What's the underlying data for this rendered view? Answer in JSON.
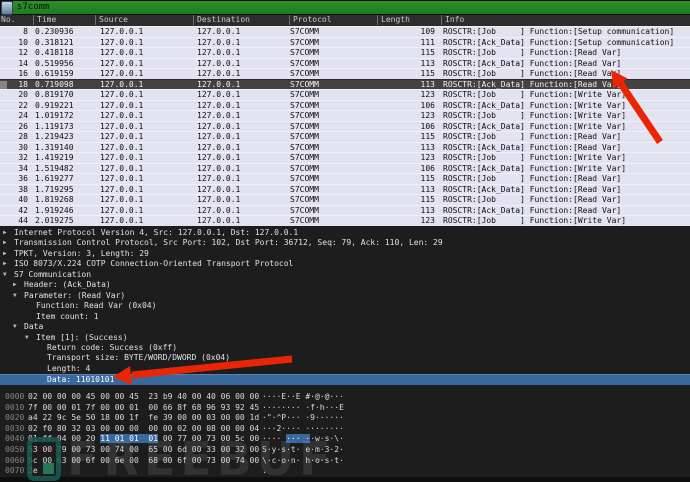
{
  "filter_bar": {
    "value": "s7comm"
  },
  "colors": {
    "filter_green": "#1e7c1e",
    "row_bg": "#e3e2f0",
    "row_selected_bg": "#45413c",
    "selection_blue": "#38689c",
    "annotation_red": "#e82504",
    "pane_bg": "#1d1d1d"
  },
  "packet_list": {
    "columns": [
      "No.",
      "Time",
      "Source",
      "Destination",
      "Protocol",
      "Length",
      "Info"
    ],
    "rows": [
      {
        "no": "8",
        "time": "0.230936",
        "source": "127.0.0.1",
        "destination": "127.0.0.1",
        "protocol": "S7COMM",
        "length": "109",
        "info": "ROSCTR:[Job     ] Function:[Setup communication]",
        "selected": false
      },
      {
        "no": "10",
        "time": "0.318121",
        "source": "127.0.0.1",
        "destination": "127.0.0.1",
        "protocol": "S7COMM",
        "length": "111",
        "info": "ROSCTR:[Ack_Data] Function:[Setup communication]",
        "selected": false
      },
      {
        "no": "12",
        "time": "0.418118",
        "source": "127.0.0.1",
        "destination": "127.0.0.1",
        "protocol": "S7COMM",
        "length": "115",
        "info": "ROSCTR:[Job     ] Function:[Read Var]",
        "selected": false
      },
      {
        "no": "14",
        "time": "0.519956",
        "source": "127.0.0.1",
        "destination": "127.0.0.1",
        "protocol": "S7COMM",
        "length": "113",
        "info": "ROSCTR:[Ack_Data] Function:[Read Var]",
        "selected": false
      },
      {
        "no": "16",
        "time": "0.619159",
        "source": "127.0.0.1",
        "destination": "127.0.0.1",
        "protocol": "S7COMM",
        "length": "115",
        "info": "ROSCTR:[Job     ] Function:[Read Var]",
        "selected": false
      },
      {
        "no": "18",
        "time": "0.719098",
        "source": "127.0.0.1",
        "destination": "127.0.0.1",
        "protocol": "S7COMM",
        "length": "113",
        "info": "ROSCTR:[Ack_Data] Function:[Read Var]",
        "selected": true
      },
      {
        "no": "20",
        "time": "0.819170",
        "source": "127.0.0.1",
        "destination": "127.0.0.1",
        "protocol": "S7COMM",
        "length": "123",
        "info": "ROSCTR:[Job     ] Function:[Write Var]",
        "selected": false
      },
      {
        "no": "22",
        "time": "0.919221",
        "source": "127.0.0.1",
        "destination": "127.0.0.1",
        "protocol": "S7COMM",
        "length": "106",
        "info": "ROSCTR:[Ack_Data] Function:[Write Var]",
        "selected": false
      },
      {
        "no": "24",
        "time": "1.019172",
        "source": "127.0.0.1",
        "destination": "127.0.0.1",
        "protocol": "S7COMM",
        "length": "123",
        "info": "ROSCTR:[Job     ] Function:[Write Var]",
        "selected": false
      },
      {
        "no": "26",
        "time": "1.119173",
        "source": "127.0.0.1",
        "destination": "127.0.0.1",
        "protocol": "S7COMM",
        "length": "106",
        "info": "ROSCTR:[Ack_Data] Function:[Write Var]",
        "selected": false
      },
      {
        "no": "28",
        "time": "1.219423",
        "source": "127.0.0.1",
        "destination": "127.0.0.1",
        "protocol": "S7COMM",
        "length": "115",
        "info": "ROSCTR:[Job     ] Function:[Read Var]",
        "selected": false
      },
      {
        "no": "30",
        "time": "1.319140",
        "source": "127.0.0.1",
        "destination": "127.0.0.1",
        "protocol": "S7COMM",
        "length": "113",
        "info": "ROSCTR:[Ack_Data] Function:[Read Var]",
        "selected": false
      },
      {
        "no": "32",
        "time": "1.419219",
        "source": "127.0.0.1",
        "destination": "127.0.0.1",
        "protocol": "S7COMM",
        "length": "123",
        "info": "ROSCTR:[Job     ] Function:[Write Var]",
        "selected": false
      },
      {
        "no": "34",
        "time": "1.519482",
        "source": "127.0.0.1",
        "destination": "127.0.0.1",
        "protocol": "S7COMM",
        "length": "106",
        "info": "ROSCTR:[Ack_Data] Function:[Write Var]",
        "selected": false
      },
      {
        "no": "36",
        "time": "1.619277",
        "source": "127.0.0.1",
        "destination": "127.0.0.1",
        "protocol": "S7COMM",
        "length": "115",
        "info": "ROSCTR:[Job     ] Function:[Read Var]",
        "selected": false
      },
      {
        "no": "38",
        "time": "1.719295",
        "source": "127.0.0.1",
        "destination": "127.0.0.1",
        "protocol": "S7COMM",
        "length": "113",
        "info": "ROSCTR:[Ack_Data] Function:[Read Var]",
        "selected": false
      },
      {
        "no": "40",
        "time": "1.819268",
        "source": "127.0.0.1",
        "destination": "127.0.0.1",
        "protocol": "S7COMM",
        "length": "115",
        "info": "ROSCTR:[Job     ] Function:[Read Var]",
        "selected": false
      },
      {
        "no": "42",
        "time": "1.919246",
        "source": "127.0.0.1",
        "destination": "127.0.0.1",
        "protocol": "S7COMM",
        "length": "113",
        "info": "ROSCTR:[Ack_Data] Function:[Read Var]",
        "selected": false
      },
      {
        "no": "44",
        "time": "2.019275",
        "source": "127.0.0.1",
        "destination": "127.0.0.1",
        "protocol": "S7COMM",
        "length": "123",
        "info": "ROSCTR:[Job     ] Function:[Write Var]",
        "selected": false
      }
    ]
  },
  "detail_tree": {
    "lines": [
      {
        "arrow": "▶",
        "indent": 0,
        "text": "Internet Protocol Version 4, Src: 127.0.0.1, Dst: 127.0.0.1",
        "selected": false
      },
      {
        "arrow": "▶",
        "indent": 0,
        "text": "Transmission Control Protocol, Src Port: 102, Dst Port: 36712, Seq: 79, Ack: 110, Len: 29",
        "selected": false
      },
      {
        "arrow": "▶",
        "indent": 0,
        "text": "TPKT, Version: 3, Length: 29",
        "selected": false
      },
      {
        "arrow": "▶",
        "indent": 0,
        "text": "ISO 8073/X.224 COTP Connection-Oriented Transport Protocol",
        "selected": false
      },
      {
        "arrow": "▼",
        "indent": 0,
        "text": "S7 Communication",
        "selected": false
      },
      {
        "arrow": "▶",
        "indent": 1,
        "text": "Header: (Ack_Data)",
        "selected": false
      },
      {
        "arrow": "▼",
        "indent": 1,
        "text": "Parameter: (Read Var)",
        "selected": false
      },
      {
        "arrow": "",
        "indent": 2,
        "text": "Function: Read Var (0x04)",
        "selected": false
      },
      {
        "arrow": "",
        "indent": 2,
        "text": "Item count: 1",
        "selected": false
      },
      {
        "arrow": "▼",
        "indent": 1,
        "text": "Data",
        "selected": false
      },
      {
        "arrow": "▼",
        "indent": 2,
        "text": "Item [1]: (Success)",
        "selected": false
      },
      {
        "arrow": "",
        "indent": 3,
        "text": "Return code: Success (0xff)",
        "selected": false
      },
      {
        "arrow": "",
        "indent": 3,
        "text": "Transport size: BYTE/WORD/DWORD (0x04)",
        "selected": false
      },
      {
        "arrow": "",
        "indent": 3,
        "text": "Length: 4",
        "selected": false
      },
      {
        "arrow": "",
        "indent": 3,
        "text": "Data: 11010101",
        "selected": true
      }
    ]
  },
  "hex_dump": {
    "rows": [
      {
        "offset": "0000",
        "hex": "02 00 00 00 45 00 00 45  23 b9 40 00 40 06 00 00",
        "ascii": "····E··E #·@·@···"
      },
      {
        "offset": "0010",
        "hex": "7f 00 00 01 7f 00 00 01  00 66 8f 68 96 93 92 45",
        "ascii": "········ ·f·h···E"
      },
      {
        "offset": "0020",
        "hex": "a4 22 9c 5e 50 18 00 1f  fe 39 00 00 03 00 00 1d",
        "ascii": "·\"·^P··· ·9······"
      },
      {
        "offset": "0030",
        "hex": "02 f0 80 32 03 00 00 00  00 00 02 00 08 00 00 04",
        "ascii": "···2···· ········"
      },
      {
        "offset": "0040",
        "hex_pre": "01 ff 04 00 20 ",
        "hex_hl": "11 01 01  01",
        "hex_post": " 00 77 00 73 00 5c 00",
        "ascii_pre": "···· ",
        "ascii_hl": "··· ·",
        "ascii_post": "·w·s·\\·"
      },
      {
        "offset": "0050",
        "hex": "53 00 79 00 73 00 74 00  65 00 6d 00 33 00 32 00",
        "ascii": "S·y·s·t· e·m·3·2·"
      },
      {
        "offset": "0060",
        "hex": "5c 00 63 00 6f 00 6e 00  68 00 6f 00 73 00 74 00",
        "ascii": "\\·c·o·n· h·o·s·t·"
      },
      {
        "offset": "0070",
        "hex": "2e",
        "ascii": "."
      }
    ]
  },
  "watermark": {
    "text": "FREEBUF"
  }
}
